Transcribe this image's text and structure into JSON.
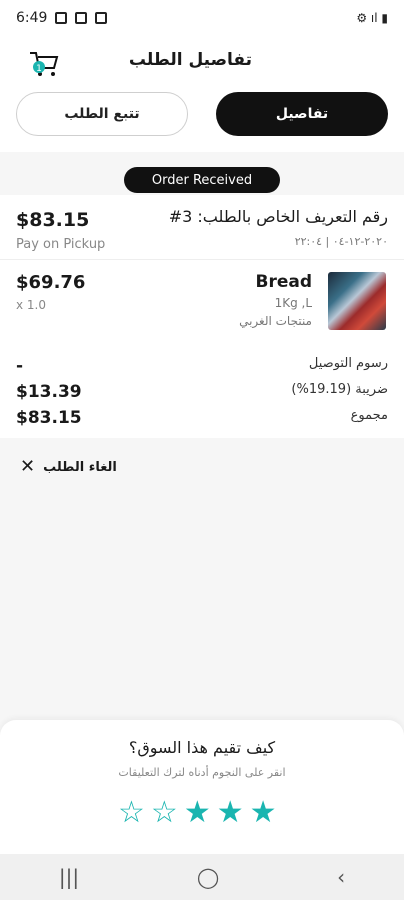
{
  "status_bar": {
    "time": "6:49",
    "right_text": "⚙ ıl ▮"
  },
  "header": {
    "title": "تفاصيل الطلب",
    "cart_icon": "cart-icon"
  },
  "tabs": [
    {
      "label": "تفاصيل"
    },
    {
      "label": "تتبع الطلب"
    }
  ],
  "order_status": "Order Received",
  "order": {
    "title": "رقم التعريف الخاص بالطلب: 3#",
    "date": "٢٠٢٠-١٢-٠٤ | ٢٢:٠٤",
    "total": "$83.15",
    "payment": "Pay on Pickup"
  },
  "product": {
    "name": "Bread",
    "variant": "1Kg ,L",
    "vendor": "منتجات الغربي",
    "price": "$69.76",
    "qty": "x 1.0"
  },
  "summary": [
    {
      "label": "رسوم التوصيل",
      "value": "-"
    },
    {
      "label": "ضريبة (19.19%)",
      "value": "$13.39"
    },
    {
      "label": "مجموع",
      "value": "$83.15"
    }
  ],
  "cancel_label": "الغاء الطلب",
  "rating": {
    "title": "كيف تقيم هذا السوق؟",
    "subtitle": "انقر على النجوم أدناه لترك التعليقات",
    "filled": 3,
    "max": 5,
    "color": "#1ab5b0"
  }
}
